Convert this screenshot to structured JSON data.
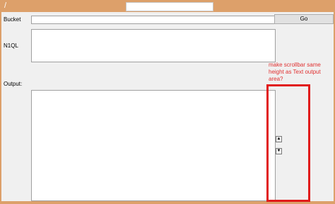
{
  "titlebar": {
    "icon": "feather-icon"
  },
  "form": {
    "bucket_label": "Bucket",
    "n1ql_label": "N1QL",
    "output_label": "Output:",
    "go_button_label": "Go"
  },
  "scrollbar": {
    "up_glyph": "▲",
    "down_glyph": "▼"
  },
  "annotation": {
    "text": "make scrollbar same height as Text output area?",
    "color": "#e11b1b"
  }
}
